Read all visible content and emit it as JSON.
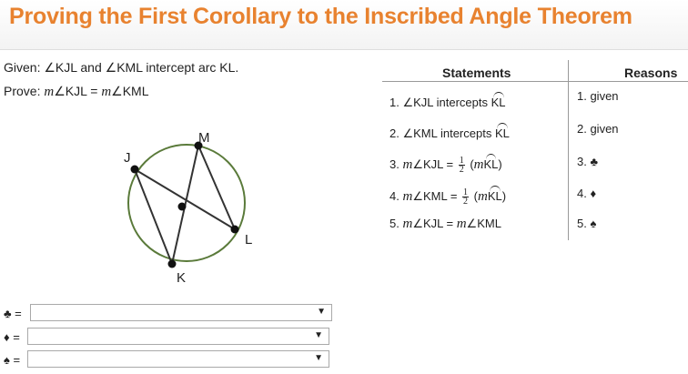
{
  "header": {
    "title": "Proving the First Corollary to the Inscribed Angle Theorem"
  },
  "problem": {
    "given": "Given: ∠KJL and ∠KML intercept arc KL.",
    "prove_prefix": "Prove: ",
    "prove_m1": "m",
    "prove_mid": "∠KJL = ",
    "prove_m2": "m",
    "prove_end": "∠KML"
  },
  "diagram": {
    "labels": {
      "J": "J",
      "M": "M",
      "K": "K",
      "L": "L"
    }
  },
  "proof": {
    "headers": {
      "statements": "Statements",
      "reasons": "Reasons"
    },
    "statements": {
      "s1_pre": "1. ∠KJL intercepts ",
      "s1_arc": "KL",
      "s2_pre": "2. ∠KML intercepts ",
      "s2_arc": "KL",
      "s3_pre": "3. ",
      "s3_m": "m",
      "s3_mid": "∠KJL = ",
      "s3_frac_n": "1",
      "s3_frac_d": "2",
      "s3_open": " (",
      "s3_m2": "m",
      "s3_arc": "KL",
      "s3_close": ")",
      "s4_pre": "4. ",
      "s4_m": "m",
      "s4_mid": "∠KML = ",
      "s4_frac_n": "1",
      "s4_frac_d": "2",
      "s4_open": " (",
      "s4_m2": "m",
      "s4_arc": "KL",
      "s4_close": ")",
      "s5_pre": "5. ",
      "s5_m": "m",
      "s5_mid": "∠KJL = ",
      "s5_m2": "m",
      "s5_end": "∠KML"
    },
    "reasons": [
      "1. given",
      "2. given",
      "3. ♣",
      "4. ♦",
      "5. ♠"
    ]
  },
  "dropdowns": [
    {
      "label": "♣ =",
      "value": ""
    },
    {
      "label": "♦ =",
      "value": ""
    },
    {
      "label": "♠ =",
      "value": ""
    }
  ],
  "icons": {
    "dropdown_arrow": "▼"
  },
  "colors": {
    "title": "#e8822f",
    "circle": "#5a7a3a"
  }
}
